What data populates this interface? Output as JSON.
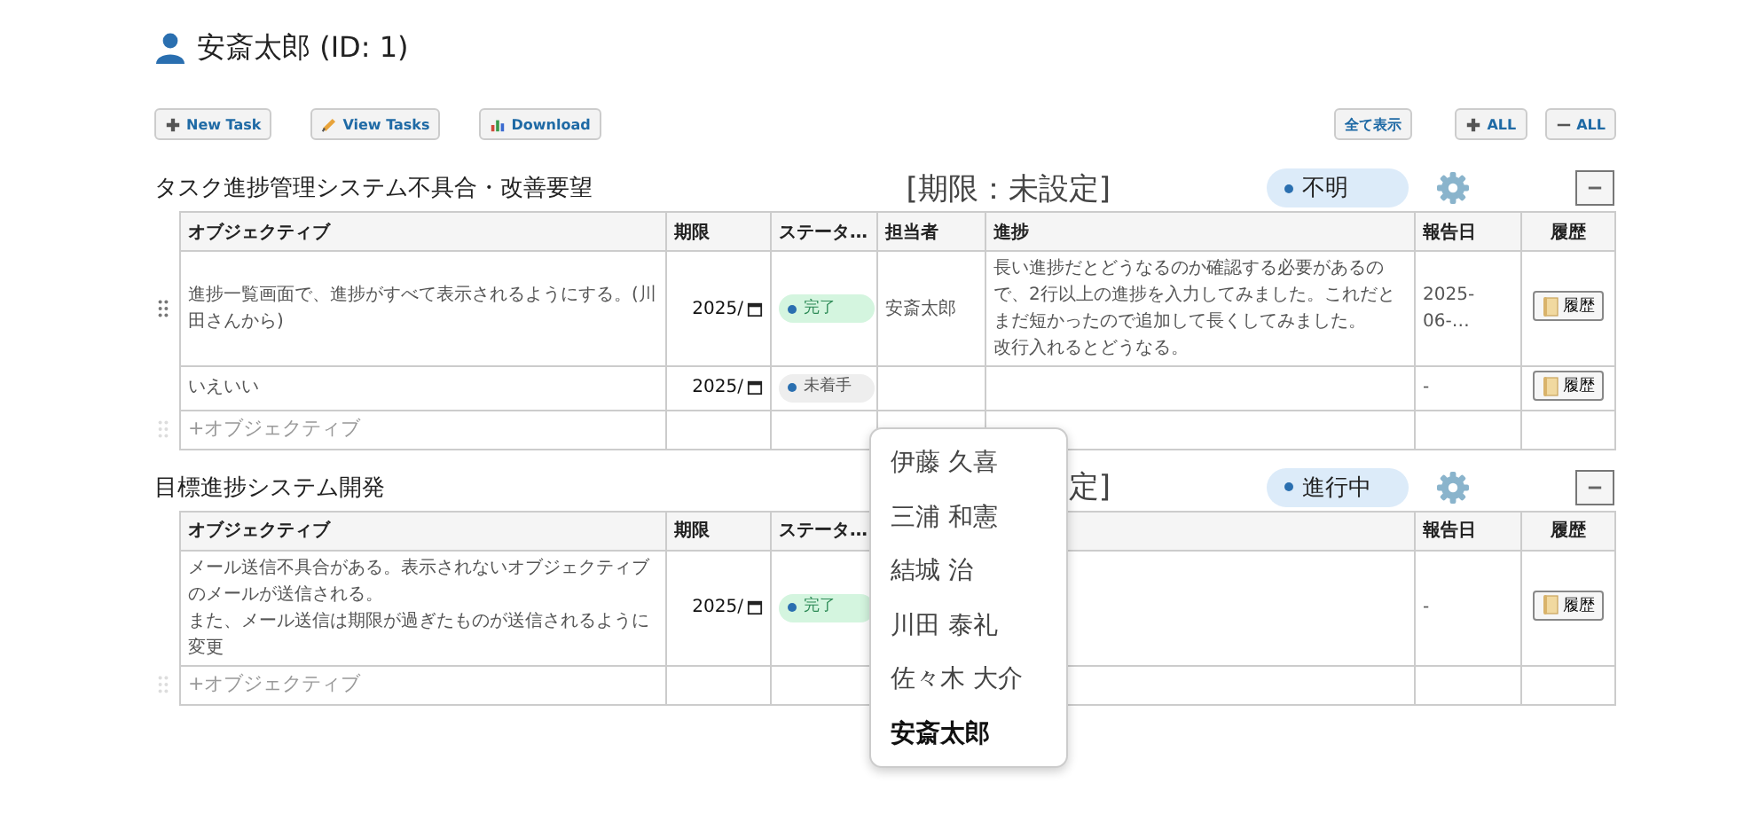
{
  "user": {
    "name": "安斎太郎 (ID: 1)"
  },
  "toolbar": {
    "left": [
      {
        "label": "New Task",
        "kind": "plus"
      },
      {
        "label": "View Tasks",
        "kind": "pencil"
      },
      {
        "label": "Download",
        "kind": "chart"
      }
    ],
    "right": [
      {
        "label": "全て表示",
        "kind": "text"
      },
      {
        "label": "ALL",
        "kind": "plus"
      },
      {
        "label": "ALL",
        "kind": "minus"
      }
    ]
  },
  "projects": [
    {
      "title": "タスク進捗管理システム不具合・改善要望",
      "deadline": "[期限：未設定]",
      "status": {
        "label": "不明"
      },
      "columns": [
        "オブジェクティブ",
        "期限",
        "ステータ…",
        "担当者",
        "進捗",
        "報告日",
        "履歴"
      ],
      "rows": [
        {
          "drag_handle": true,
          "objective": [
            "進捗一覧画面で、進捗がすべて表示されるようにする。(川田さんから)"
          ],
          "deadline": "2025/",
          "status": {
            "label": "完了",
            "kind": "done"
          },
          "assignee": "安斎太郎",
          "progress": [
            "長い進捗だとどうなるのか確認する必要があるので、2行以上の進捗を入力してみました。これだとまだ短かったので追加して長くしてみました。",
            "改行入れるとどうなる。"
          ],
          "report_date": "2025-06-…",
          "history": "履歴"
        },
        {
          "drag_handle": false,
          "objective": [
            "いえいい"
          ],
          "deadline": "2025/",
          "status": {
            "label": "未着手",
            "kind": "todo"
          },
          "report_date": "-",
          "history": "履歴"
        }
      ],
      "add_label": "+オブジェクティブ"
    },
    {
      "title": "目標進捗システム開発",
      "deadline": "定]",
      "status": {
        "label": "進行中"
      },
      "columns": [
        "オブジェクティブ",
        "期限",
        "ステータ…",
        null,
        null,
        "報告日",
        "履歴"
      ],
      "rows": [
        {
          "drag_handle": false,
          "objective": [
            "メール送信不具合がある。表示されないオブジェクティブのメールが送信される。",
            "また、メール送信は期限が過ぎたものが送信されるように変更"
          ],
          "deadline": "2025/",
          "status": {
            "label": "完了",
            "kind": "done"
          },
          "report_date": "-",
          "history": "履歴"
        }
      ],
      "add_label": "+オブジェクティブ"
    }
  ],
  "assignee_dropdown": {
    "options": [
      {
        "label": "伊藤 久喜",
        "selected": false
      },
      {
        "label": "三浦 和憲",
        "selected": false
      },
      {
        "label": "結城 治",
        "selected": false
      },
      {
        "label": "川田 泰礼",
        "selected": false
      },
      {
        "label": "佐々木 大介",
        "selected": false
      },
      {
        "label": "安斎太郎",
        "selected": true
      }
    ]
  }
}
